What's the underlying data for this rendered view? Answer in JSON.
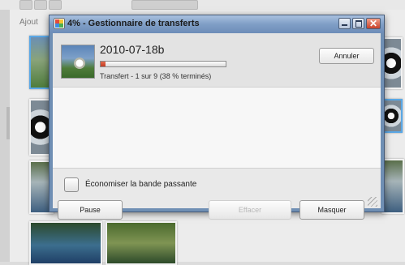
{
  "background": {
    "ajout_label": "Ajout"
  },
  "dialog": {
    "title": "4% - Gestionnaire de transferts",
    "item": {
      "name": "2010-07-18b",
      "progress_percent": 4,
      "status": "Transfert - 1 sur 9 (38 % terminés)",
      "cancel_label": "Annuler"
    },
    "bandwidth_checkbox": {
      "label": "Économiser la bande passante",
      "checked": false
    },
    "buttons": {
      "pause": "Pause",
      "clear": "Effacer",
      "hide": "Masquer"
    }
  },
  "colors": {
    "title_bar": "#7f9ec6",
    "progress_fill": "#c23c24",
    "close_button": "#c9412a",
    "selection": "#5aa8e6"
  },
  "icons": {
    "title": "photo-app-icon",
    "minimize": "minimize-icon",
    "maximize": "maximize-icon",
    "close": "close-icon",
    "resize": "resize-grip-icon"
  }
}
